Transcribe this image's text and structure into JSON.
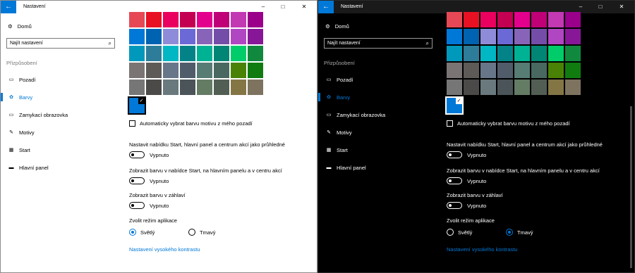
{
  "window": {
    "title": "Nastavení",
    "back_glyph": "←",
    "minimize_glyph": "–",
    "maximize_glyph": "□",
    "close_glyph": "✕"
  },
  "nav": {
    "home_label": "Domů",
    "search_placeholder": "Najít nastavení",
    "section_label": "Přizpůsobení",
    "items": [
      {
        "label": "Pozadí",
        "icon": "image-icon",
        "selected": false
      },
      {
        "label": "Barvy",
        "icon": "palette-icon",
        "selected": true
      },
      {
        "label": "Zamykací obrazovka",
        "icon": "lock-screen-icon",
        "selected": false
      },
      {
        "label": "Motivy",
        "icon": "brush-icon",
        "selected": false
      },
      {
        "label": "Start",
        "icon": "start-icon",
        "selected": false
      },
      {
        "label": "Hlavní panel",
        "icon": "taskbar-icon",
        "selected": false
      }
    ]
  },
  "colors": {
    "accent": "#0078d7",
    "swatches": [
      "#e74856",
      "#e81123",
      "#ea005e",
      "#c30052",
      "#e3008c",
      "#bf0077",
      "#c239b3",
      "#9a0089",
      "#0078d7",
      "#0063b1",
      "#8e8cd8",
      "#6b69d6",
      "#8764b8",
      "#744da9",
      "#b146c2",
      "#881798",
      "#0099bc",
      "#2d7d9a",
      "#00b7c3",
      "#038387",
      "#00b294",
      "#018574",
      "#00cc6a",
      "#10893e",
      "#7a7574",
      "#5d5a58",
      "#68768a",
      "#515c6b",
      "#567c73",
      "#486860",
      "#498205",
      "#107c10",
      "#767676",
      "#4c4a48",
      "#69797e",
      "#4a5459",
      "#647c64",
      "#525e54",
      "#847545",
      "#7e735f"
    ],
    "selected_swatch": "#0078d7",
    "check_glyph": "✓"
  },
  "settings": {
    "auto_pick_label": "Automaticky vybrat barvu motivu z mého pozadí",
    "start_transparent_label": "Nastavit nabídku Start, hlavní panel a centrum akcí jako průhledné",
    "start_transparent_state": "Vypnuto",
    "show_color_start_label": "Zobrazit barvu v nabídce Start, na hlavním panelu a v centru akcí",
    "show_color_start_state": "Vypnuto",
    "show_color_title_label": "Zobrazit barvu v záhlaví",
    "show_color_title_state": "Vypnuto",
    "app_mode_label": "Zvolit režim aplikace",
    "mode_light": "Světlý",
    "mode_dark": "Tmavý",
    "high_contrast_link": "Nastavení vysokého kontrastu"
  },
  "panels": [
    {
      "theme": "light",
      "selected_mode": "light"
    },
    {
      "theme": "dark",
      "selected_mode": "dark"
    }
  ]
}
